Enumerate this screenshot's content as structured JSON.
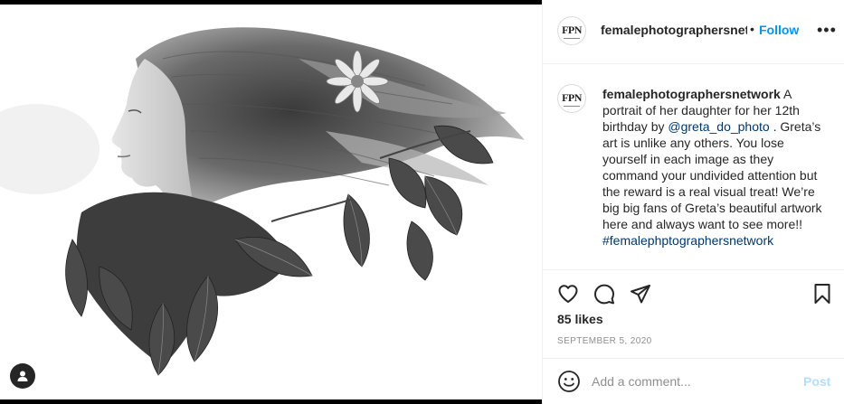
{
  "post": {
    "image_alt": "Double exposure portrait of a girl with flowing hair and leaves",
    "user_tag_icon": "user-tag-icon"
  },
  "header": {
    "avatar_text": "FPN",
    "username": "femalephotographersnetwork",
    "separator": "•",
    "follow_label": "Follow",
    "more_icon": "more-options-icon",
    "more_label": "•••"
  },
  "caption": {
    "avatar_text": "FPN",
    "username": "femalephotographersnetwork",
    "text_before_mention": "A portrait of her daughter for her 12th birthday by ",
    "mention": "@greta_do_photo",
    "text_after_mention": " . Greta’s art is unlike any others. You lose yourself in each image as they command your undivided attention but the reward is a real visual treat! We’re big big fans of Greta’s beautiful artwork here and always want to see more!! ",
    "hashtag": "#femalephptographersnetwork"
  },
  "actions": {
    "like_icon": "heart-icon",
    "comment_icon": "comment-icon",
    "share_icon": "paper-plane-icon",
    "save_icon": "bookmark-icon",
    "likes": "85 likes",
    "date": "SEPTEMBER 5, 2020"
  },
  "comment": {
    "emoji_icon": "emoji-icon",
    "placeholder": "Add a comment...",
    "post_label": "Post"
  },
  "colors": {
    "accent": "#0095f6",
    "link": "#00376b",
    "muted": "#8e8e8e",
    "post_disabled": "#b2dffc"
  }
}
